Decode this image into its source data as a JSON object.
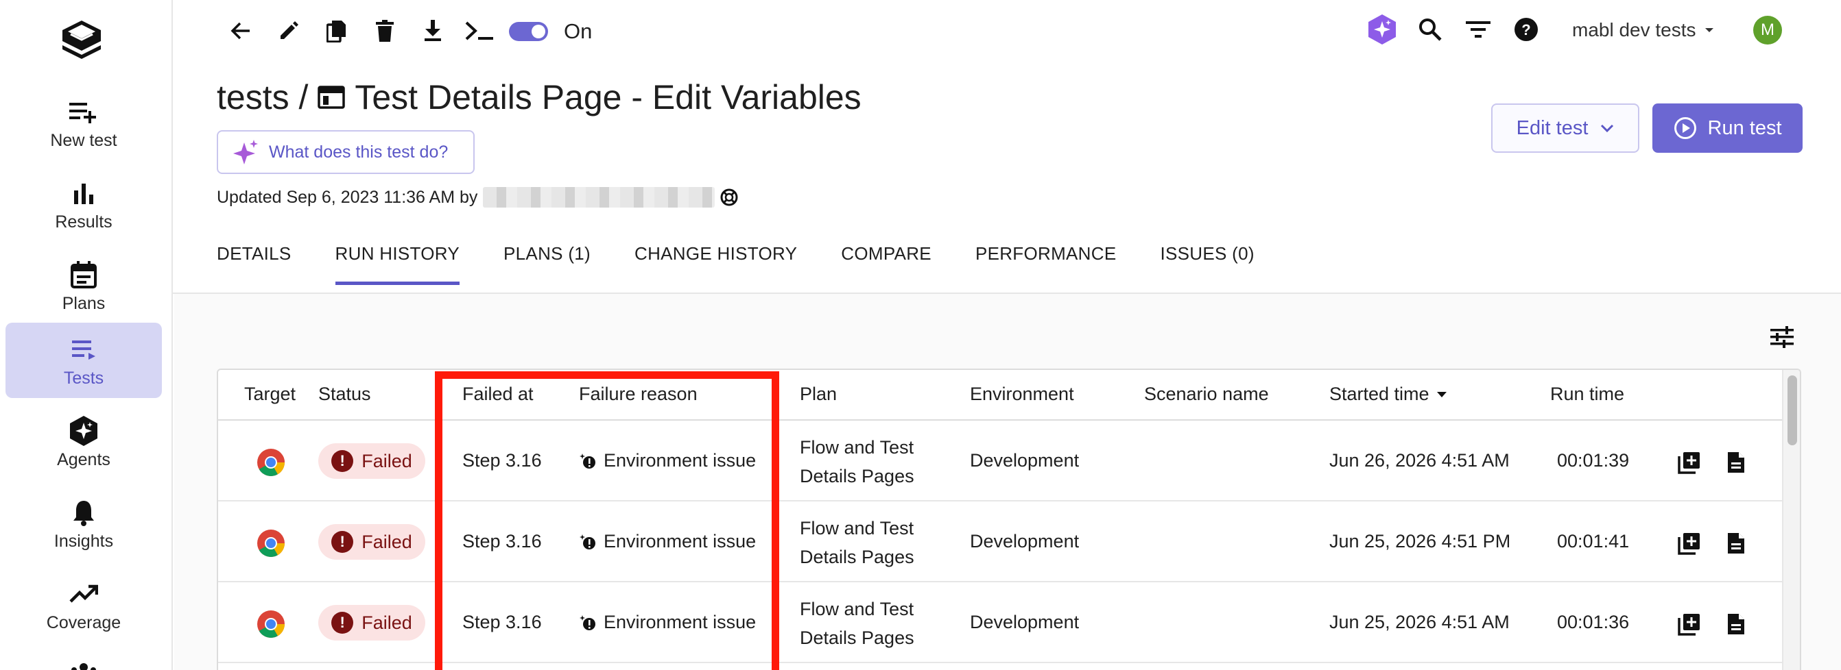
{
  "sidebar": {
    "items": [
      {
        "label": "New test",
        "icon": "playlist-add-icon"
      },
      {
        "label": "Results",
        "icon": "bar-chart-icon"
      },
      {
        "label": "Plans",
        "icon": "calendar-icon"
      },
      {
        "label": "Tests",
        "icon": "list-icon",
        "active": true
      },
      {
        "label": "Agents",
        "icon": "agent-sparkle-icon"
      },
      {
        "label": "Insights",
        "icon": "bell-icon"
      },
      {
        "label": "Coverage",
        "icon": "trending-up-icon"
      }
    ]
  },
  "toolbar": {
    "toggle_label": "On",
    "toggle_on": true
  },
  "header": {
    "workspace": "mabl dev tests",
    "avatar_initial": "M"
  },
  "page": {
    "breadcrumb": "tests /",
    "title": "Test Details Page - Edit Variables",
    "ask_label": "What does this test do?",
    "updated_text": "Updated Sep 6, 2023 11:36 AM by",
    "edit_label": "Edit test",
    "run_label": "Run test"
  },
  "tabs": [
    {
      "label": "DETAILS"
    },
    {
      "label": "RUN HISTORY",
      "active": true
    },
    {
      "label": "PLANS (1)"
    },
    {
      "label": "CHANGE HISTORY"
    },
    {
      "label": "COMPARE"
    },
    {
      "label": "PERFORMANCE"
    },
    {
      "label": "ISSUES (0)"
    }
  ],
  "table": {
    "columns": {
      "target": "Target",
      "status": "Status",
      "failed_at": "Failed at",
      "failure_reason": "Failure reason",
      "plan": "Plan",
      "environment": "Environment",
      "scenario": "Scenario name",
      "started": "Started time",
      "run_time": "Run time"
    },
    "rows": [
      {
        "target": "chrome",
        "status": "Failed",
        "failed_at": "Step 3.16",
        "failure_reason": "Environment issue",
        "plan_line1": "Flow and Test",
        "plan_line2": "Details Pages",
        "environment": "Development",
        "scenario": "",
        "started": "Jun 26, 2026 4:51 AM",
        "run_time": "00:01:39"
      },
      {
        "target": "chrome",
        "status": "Failed",
        "failed_at": "Step 3.16",
        "failure_reason": "Environment issue",
        "plan_line1": "Flow and Test",
        "plan_line2": "Details Pages",
        "environment": "Development",
        "scenario": "",
        "started": "Jun 25, 2026 4:51 PM",
        "run_time": "00:01:41"
      },
      {
        "target": "chrome",
        "status": "Failed",
        "failed_at": "Step 3.16",
        "failure_reason": "Environment issue",
        "plan_line1": "Flow and Test",
        "plan_line2": "Details Pages",
        "environment": "Development",
        "scenario": "",
        "started": "Jun 25, 2026 4:51 AM",
        "run_time": "00:01:36"
      }
    ]
  },
  "colors": {
    "accent": "#6c67d2",
    "failed_bg": "#fbe3e3",
    "failed_text": "#7a1212",
    "highlight": "#ff1a0a"
  }
}
